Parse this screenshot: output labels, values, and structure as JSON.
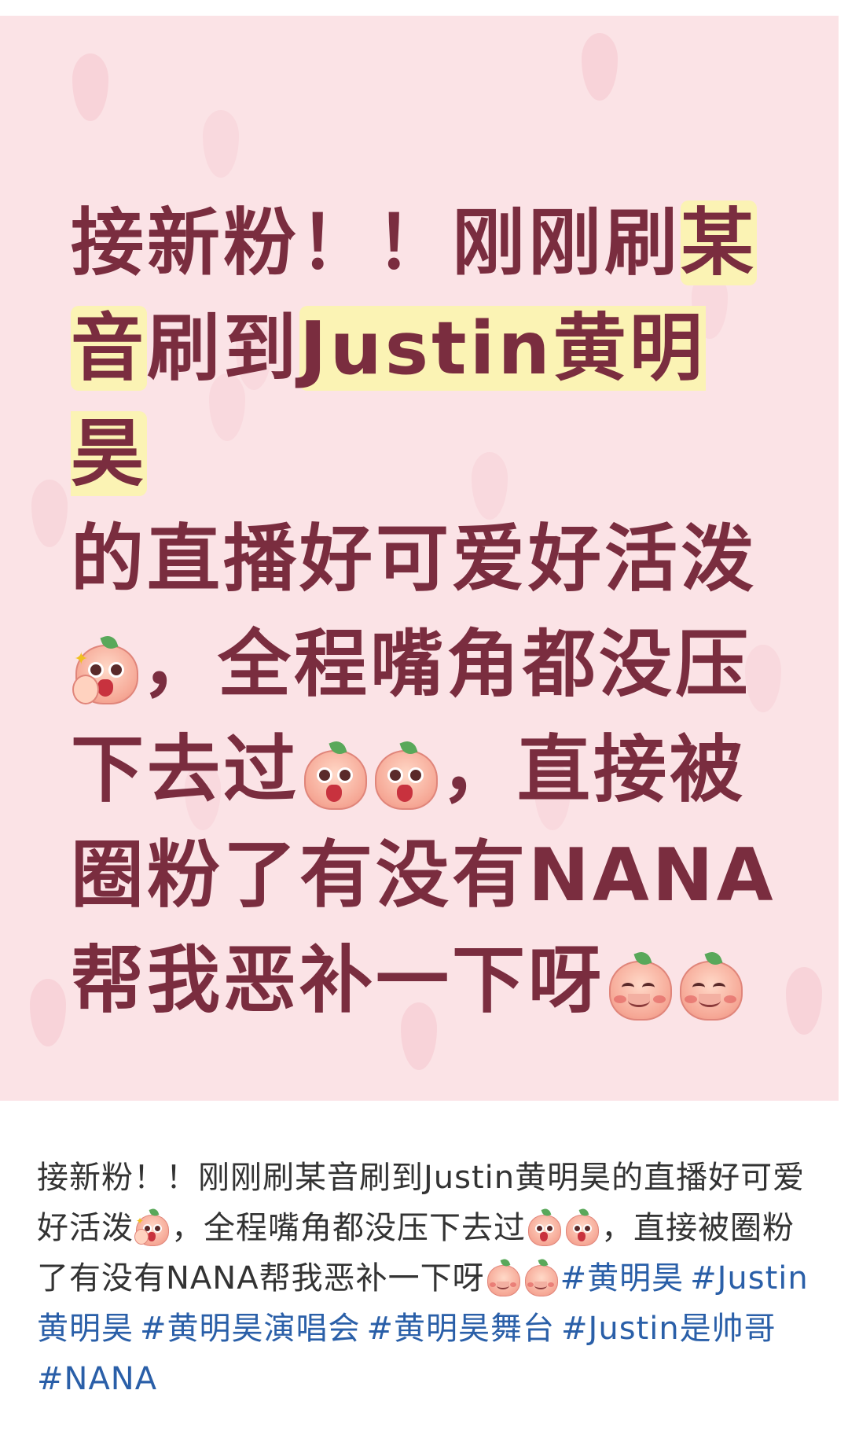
{
  "poster": {
    "line1_a": "接新粉！！刚刚刷",
    "line1_hl": "某",
    "line2_hl1": "音",
    "line2_mid": "刷到",
    "line2_hl2": "Justin黄明昊",
    "line3": "的直播好可爱好活泼",
    "line4": "，全程嘴角都没压",
    "line5_a": "下去过",
    "line5_b": "，直接被",
    "line6": "圈粉了有没有NANA",
    "line7": "帮我恶补一下呀",
    "colors": {
      "background": "#fbe3e6",
      "text": "#7a2d3f",
      "highlight": "#fbf3b4"
    }
  },
  "caption": {
    "text1": "接新粉！！刚刚刷某音刷到Justin黄明昊的直播好可爱好活泼",
    "text2": "，全程嘴角都没压下去过",
    "text3": "，直接被圈粉了有没有NANA帮我恶补一下呀",
    "hashtags": [
      "#黄明昊",
      "#Justin黄明昊",
      "#黄明昊演唱会",
      "#黄明昊舞台",
      "#Justin是帅哥",
      "#NANA"
    ],
    "colors": {
      "text": "#333333",
      "hashtag": "#2a5fa8"
    }
  },
  "icons": {
    "emoji_cool": "peach-cool-emoji-icon",
    "emoji_shocked": "peach-shocked-emoji-icon",
    "emoji_happy": "peach-happy-emoji-icon"
  }
}
